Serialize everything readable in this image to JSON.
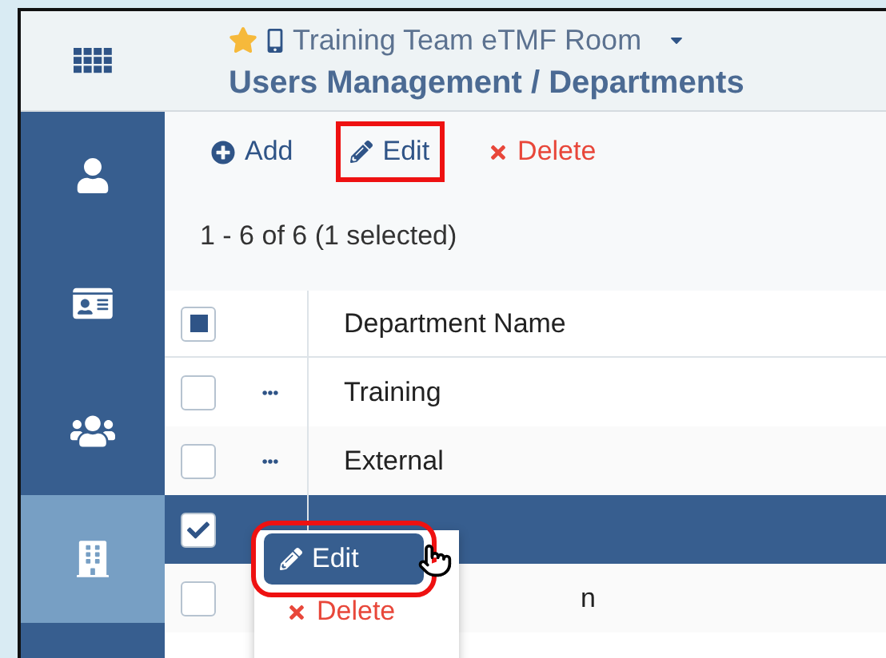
{
  "header": {
    "room": "Training Team eTMF Room",
    "title": "Users Management / Departments"
  },
  "sidebar": {
    "items": [
      {
        "kind": "user",
        "selected": false
      },
      {
        "kind": "card",
        "selected": false
      },
      {
        "kind": "group",
        "selected": false
      },
      {
        "kind": "building",
        "selected": true
      }
    ]
  },
  "toolbar": [
    {
      "kind": "add",
      "label": "Add",
      "highlighted": false
    },
    {
      "kind": "edit",
      "label": "Edit",
      "highlighted": true
    },
    {
      "kind": "delete",
      "label": "Delete",
      "highlighted": false
    }
  ],
  "count": "1 - 6 of 6 (1 selected)",
  "table": {
    "columns": [
      "Department Name"
    ],
    "header_partial": true,
    "rows": [
      {
        "name": "Training",
        "checked": false,
        "menu": true
      },
      {
        "name": "External",
        "checked": false,
        "menu": true
      },
      {
        "checked": true,
        "menu": false
      },
      {
        "name": "n",
        "checked": false,
        "menu": false
      }
    ]
  },
  "context_menu": {
    "items": [
      {
        "kind": "edit",
        "label": "Edit",
        "highlighted": true
      },
      {
        "kind": "delete",
        "label": "Delete",
        "highlighted": false
      }
    ]
  }
}
